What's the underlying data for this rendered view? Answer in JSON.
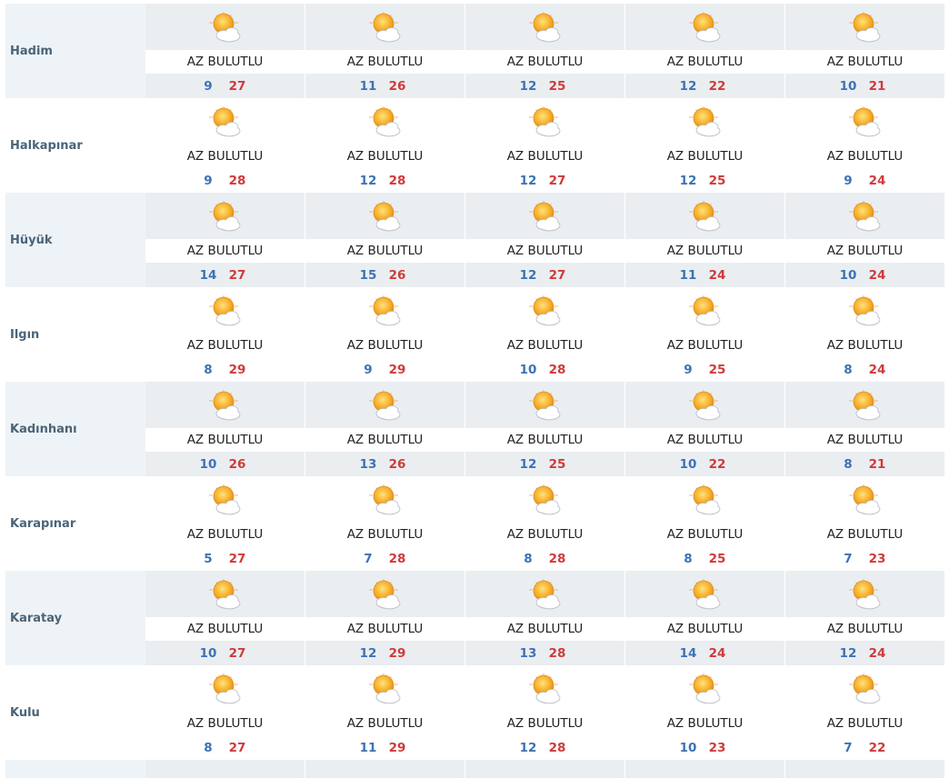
{
  "condition_icon": "partly-sunny-icon",
  "colors": {
    "min_temp": "#3d72b4",
    "max_temp": "#d03a3a",
    "city_label": "#4a6478",
    "row_shade": "#eaeef1"
  },
  "cities": [
    {
      "name": "Hadim",
      "days": [
        {
          "condition": "AZ BULUTLU",
          "min": "9",
          "max": "27"
        },
        {
          "condition": "AZ BULUTLU",
          "min": "11",
          "max": "26"
        },
        {
          "condition": "AZ BULUTLU",
          "min": "12",
          "max": "25"
        },
        {
          "condition": "AZ BULUTLU",
          "min": "12",
          "max": "22"
        },
        {
          "condition": "AZ BULUTLU",
          "min": "10",
          "max": "21"
        }
      ]
    },
    {
      "name": "Halkapınar",
      "days": [
        {
          "condition": "AZ BULUTLU",
          "min": "9",
          "max": "28"
        },
        {
          "condition": "AZ BULUTLU",
          "min": "12",
          "max": "28"
        },
        {
          "condition": "AZ BULUTLU",
          "min": "12",
          "max": "27"
        },
        {
          "condition": "AZ BULUTLU",
          "min": "12",
          "max": "25"
        },
        {
          "condition": "AZ BULUTLU",
          "min": "9",
          "max": "24"
        }
      ]
    },
    {
      "name": "Hüyük",
      "days": [
        {
          "condition": "AZ BULUTLU",
          "min": "14",
          "max": "27"
        },
        {
          "condition": "AZ BULUTLU",
          "min": "15",
          "max": "26"
        },
        {
          "condition": "AZ BULUTLU",
          "min": "12",
          "max": "27"
        },
        {
          "condition": "AZ BULUTLU",
          "min": "11",
          "max": "24"
        },
        {
          "condition": "AZ BULUTLU",
          "min": "10",
          "max": "24"
        }
      ]
    },
    {
      "name": "Ilgın",
      "days": [
        {
          "condition": "AZ BULUTLU",
          "min": "8",
          "max": "29"
        },
        {
          "condition": "AZ BULUTLU",
          "min": "9",
          "max": "29"
        },
        {
          "condition": "AZ BULUTLU",
          "min": "10",
          "max": "28"
        },
        {
          "condition": "AZ BULUTLU",
          "min": "9",
          "max": "25"
        },
        {
          "condition": "AZ BULUTLU",
          "min": "8",
          "max": "24"
        }
      ]
    },
    {
      "name": "Kadınhanı",
      "days": [
        {
          "condition": "AZ BULUTLU",
          "min": "10",
          "max": "26"
        },
        {
          "condition": "AZ BULUTLU",
          "min": "13",
          "max": "26"
        },
        {
          "condition": "AZ BULUTLU",
          "min": "12",
          "max": "25"
        },
        {
          "condition": "AZ BULUTLU",
          "min": "10",
          "max": "22"
        },
        {
          "condition": "AZ BULUTLU",
          "min": "8",
          "max": "21"
        }
      ]
    },
    {
      "name": "Karapınar",
      "days": [
        {
          "condition": "AZ BULUTLU",
          "min": "5",
          "max": "27"
        },
        {
          "condition": "AZ BULUTLU",
          "min": "7",
          "max": "28"
        },
        {
          "condition": "AZ BULUTLU",
          "min": "8",
          "max": "28"
        },
        {
          "condition": "AZ BULUTLU",
          "min": "8",
          "max": "25"
        },
        {
          "condition": "AZ BULUTLU",
          "min": "7",
          "max": "23"
        }
      ]
    },
    {
      "name": "Karatay",
      "days": [
        {
          "condition": "AZ BULUTLU",
          "min": "10",
          "max": "27"
        },
        {
          "condition": "AZ BULUTLU",
          "min": "12",
          "max": "29"
        },
        {
          "condition": "AZ BULUTLU",
          "min": "13",
          "max": "28"
        },
        {
          "condition": "AZ BULUTLU",
          "min": "14",
          "max": "24"
        },
        {
          "condition": "AZ BULUTLU",
          "min": "12",
          "max": "24"
        }
      ]
    },
    {
      "name": "Kulu",
      "days": [
        {
          "condition": "AZ BULUTLU",
          "min": "8",
          "max": "27"
        },
        {
          "condition": "AZ BULUTLU",
          "min": "11",
          "max": "29"
        },
        {
          "condition": "AZ BULUTLU",
          "min": "12",
          "max": "28"
        },
        {
          "condition": "AZ BULUTLU",
          "min": "10",
          "max": "23"
        },
        {
          "condition": "AZ BULUTLU",
          "min": "7",
          "max": "22"
        }
      ]
    }
  ]
}
